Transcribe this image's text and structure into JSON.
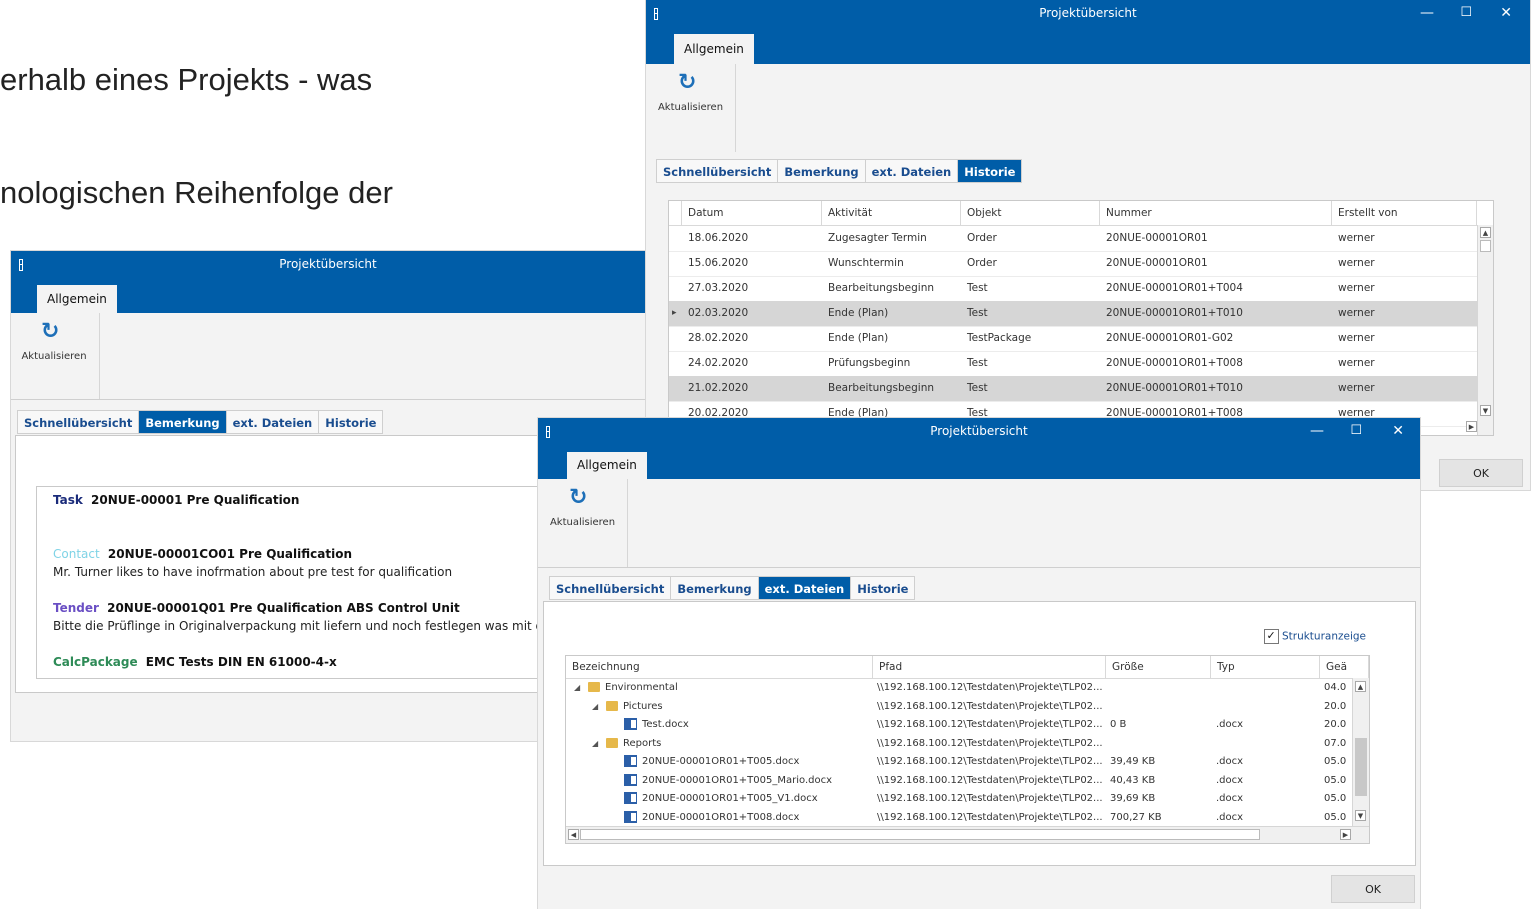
{
  "slide": {
    "line1": "erhalb eines Projekts - was",
    "line2": "nologischen Reihenfolge der"
  },
  "colors": {
    "titlebar": "#005da8",
    "active_tab": "#005da8",
    "tab_text": "#1a4d8f"
  },
  "windows": {
    "bemerkung": {
      "title": "Projektübersicht",
      "ribbon_tab": "Allgemein",
      "refresh_label": "Aktualisieren",
      "tabs": [
        "Schnellübersicht",
        "Bemerkung",
        "ext. Dateien",
        "Historie"
      ],
      "notes": [
        {
          "type": "Task",
          "type_color": "#1a2b7a",
          "ref": "20NUE-00001 Pre Qualification",
          "text": ""
        },
        {
          "type": "Contact",
          "type_color": "#7fd3e6",
          "ref": "20NUE-00001CO01 Pre Qualification",
          "text": "Mr. Turner likes to have inofrmation about pre test for qualification"
        },
        {
          "type": "Tender",
          "type_color": "#6a4fc4",
          "ref": "20NUE-00001Q01 Pre Qualification ABS Control Unit",
          "text": "Bitte die Prüflinge in Originalverpackung mit liefern und noch festlegen was mit de"
        },
        {
          "type": "CalcPackage",
          "type_color": "#2e8b57",
          "ref": "EMC Tests DIN EN 61000-4-x",
          "text": ""
        }
      ]
    },
    "historie": {
      "title": "Projektübersicht",
      "ribbon_tab": "Allgemein",
      "refresh_label": "Aktualisieren",
      "tabs": [
        "Schnellübersicht",
        "Bemerkung",
        "ext. Dateien",
        "Historie"
      ],
      "columns": [
        "Datum",
        "Aktivität",
        "Objekt",
        "Nummer",
        "Erstellt von"
      ],
      "rows": [
        [
          "18.06.2020",
          "Zugesagter Termin",
          "Order",
          "20NUE-00001OR01",
          "werner"
        ],
        [
          "15.06.2020",
          "Wunschtermin",
          "Order",
          "20NUE-00001OR01",
          "werner"
        ],
        [
          "27.03.2020",
          "Bearbeitungsbeginn",
          "Test",
          "20NUE-00001OR01+T004",
          "werner"
        ],
        [
          "02.03.2020",
          "Ende (Plan)",
          "Test",
          "20NUE-00001OR01+T010",
          "werner"
        ],
        [
          "28.02.2020",
          "Ende (Plan)",
          "TestPackage",
          "20NUE-00001OR01-G02",
          "werner"
        ],
        [
          "24.02.2020",
          "Prüfungsbeginn",
          "Test",
          "20NUE-00001OR01+T008",
          "werner"
        ],
        [
          "21.02.2020",
          "Bearbeitungsbeginn",
          "Test",
          "20NUE-00001OR01+T010",
          "werner"
        ],
        [
          "20.02.2020",
          "Ende (Plan)",
          "Test",
          "20NUE-00001OR01+T008",
          "werner"
        ]
      ],
      "ok_label": "OK"
    },
    "dateien": {
      "title": "Projektübersicht",
      "ribbon_tab": "Allgemein",
      "refresh_label": "Aktualisieren",
      "tabs": [
        "Schnellübersicht",
        "Bemerkung",
        "ext. Dateien",
        "Historie"
      ],
      "structure_label": "Strukturanzeige",
      "structure_checked": true,
      "columns": [
        "Bezeichnung",
        "Pfad",
        "Größe",
        "Typ",
        "Geä"
      ],
      "rows": [
        {
          "level": 0,
          "kind": "folder",
          "expanded": true,
          "name": "Environmental",
          "path": "\\\\192.168.100.12\\Testdaten\\Projekte\\TLP02...",
          "size": "",
          "type": "",
          "date": "04.0"
        },
        {
          "level": 1,
          "kind": "folder",
          "expanded": true,
          "name": "Pictures",
          "path": "\\\\192.168.100.12\\Testdaten\\Projekte\\TLP02...",
          "size": "",
          "type": "",
          "date": "20.0"
        },
        {
          "level": 2,
          "kind": "doc",
          "name": "Test.docx",
          "path": "\\\\192.168.100.12\\Testdaten\\Projekte\\TLP02...",
          "size": "0 B",
          "type": ".docx",
          "date": "20.0"
        },
        {
          "level": 1,
          "kind": "folder",
          "expanded": true,
          "name": "Reports",
          "path": "\\\\192.168.100.12\\Testdaten\\Projekte\\TLP02...",
          "size": "",
          "type": "",
          "date": "07.0"
        },
        {
          "level": 2,
          "kind": "doc",
          "name": "20NUE-00001OR01+T005.docx",
          "path": "\\\\192.168.100.12\\Testdaten\\Projekte\\TLP02...",
          "size": "39,49 KB",
          "type": ".docx",
          "date": "05.0"
        },
        {
          "level": 2,
          "kind": "doc",
          "name": "20NUE-00001OR01+T005_Mario.docx",
          "path": "\\\\192.168.100.12\\Testdaten\\Projekte\\TLP02...",
          "size": "40,43 KB",
          "type": ".docx",
          "date": "05.0"
        },
        {
          "level": 2,
          "kind": "doc",
          "name": "20NUE-00001OR01+T005_V1.docx",
          "path": "\\\\192.168.100.12\\Testdaten\\Projekte\\TLP02...",
          "size": "39,69 KB",
          "type": ".docx",
          "date": "05.0"
        },
        {
          "level": 2,
          "kind": "doc",
          "name": "20NUE-00001OR01+T008.docx",
          "path": "\\\\192.168.100.12\\Testdaten\\Projekte\\TLP02...",
          "size": "700,27 KB",
          "type": ".docx",
          "date": "05.0"
        }
      ],
      "ok_label": "OK"
    }
  }
}
